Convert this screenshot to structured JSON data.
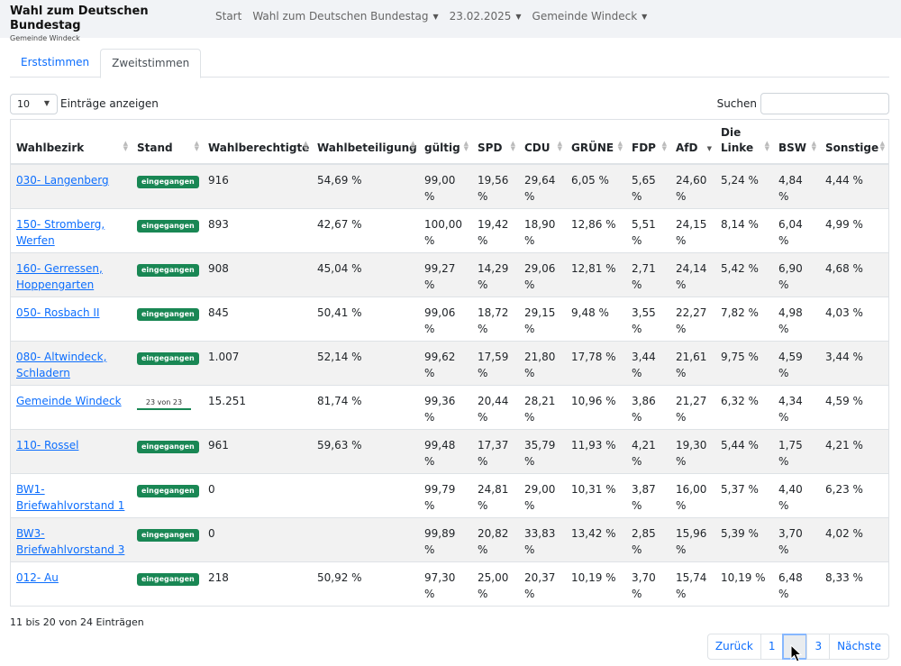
{
  "header": {
    "brand_title": "Wahl zum Deutschen Bundestag",
    "brand_subtitle": "Gemeinde Windeck",
    "nav": [
      {
        "label": "Start",
        "dropdown": false
      },
      {
        "label": "Wahl zum Deutschen Bundestag",
        "dropdown": true
      },
      {
        "label": "23.02.2025",
        "dropdown": true
      },
      {
        "label": "Gemeinde Windeck",
        "dropdown": true
      }
    ]
  },
  "tabs": [
    {
      "label": "Erststimmen",
      "active": false
    },
    {
      "label": "Zweitstimmen",
      "active": true
    }
  ],
  "controls": {
    "length_value": "10",
    "length_label": "Einträge anzeigen",
    "search_label": "Suchen",
    "search_value": ""
  },
  "table": {
    "columns": [
      "Wahlbezirk",
      "Stand",
      "Wahlberechtigte",
      "Wahlbeteiligung",
      "gültig",
      "SPD",
      "CDU",
      "GRÜNE",
      "FDP",
      "AfD",
      "Die Linke",
      "BSW",
      "Sonstige"
    ],
    "sorted_column": "AfD",
    "rows": [
      {
        "district": "030- Langenberg",
        "status": "eingegangen",
        "eligible": "916",
        "turnout": "54,69 %",
        "valid": "99,00 %",
        "spd": "19,56 %",
        "cdu": "29,64 %",
        "gruene": "6,05 %",
        "fdp": "5,65 %",
        "afd": "24,60 %",
        "linke": "5,24 %",
        "bsw": "4,84 %",
        "sonstige": "4,44 %"
      },
      {
        "district": "150- Stromberg, Werfen",
        "status": "eingegangen",
        "eligible": "893",
        "turnout": "42,67 %",
        "valid": "100,00 %",
        "spd": "19,42 %",
        "cdu": "18,90 %",
        "gruene": "12,86 %",
        "fdp": "5,51 %",
        "afd": "24,15 %",
        "linke": "8,14 %",
        "bsw": "6,04 %",
        "sonstige": "4,99 %"
      },
      {
        "district": "160- Gerressen, Hoppengarten",
        "status": "eingegangen",
        "eligible": "908",
        "turnout": "45,04 %",
        "valid": "99,27 %",
        "spd": "14,29 %",
        "cdu": "29,06 %",
        "gruene": "12,81 %",
        "fdp": "2,71 %",
        "afd": "24,14 %",
        "linke": "5,42 %",
        "bsw": "6,90 %",
        "sonstige": "4,68 %"
      },
      {
        "district": "050- Rosbach II",
        "status": "eingegangen",
        "eligible": "845",
        "turnout": "50,41 %",
        "valid": "99,06 %",
        "spd": "18,72 %",
        "cdu": "29,15 %",
        "gruene": "9,48 %",
        "fdp": "3,55 %",
        "afd": "22,27 %",
        "linke": "7,82 %",
        "bsw": "4,98 %",
        "sonstige": "4,03 %"
      },
      {
        "district": "080- Altwindeck, Schladern",
        "status": "eingegangen",
        "eligible": "1.007",
        "turnout": "52,14 %",
        "valid": "99,62 %",
        "spd": "17,59 %",
        "cdu": "21,80 %",
        "gruene": "17,78 %",
        "fdp": "3,44 %",
        "afd": "21,61 %",
        "linke": "9,75 %",
        "bsw": "4,59 %",
        "sonstige": "3,44 %"
      },
      {
        "district": "Gemeinde Windeck",
        "status": "23 von 23",
        "status_type": "progress",
        "progress": 1.0,
        "eligible": "15.251",
        "turnout": "81,74 %",
        "valid": "99,36 %",
        "spd": "20,44 %",
        "cdu": "28,21 %",
        "gruene": "10,96 %",
        "fdp": "3,86 %",
        "afd": "21,27 %",
        "linke": "6,32 %",
        "bsw": "4,34 %",
        "sonstige": "4,59 %"
      },
      {
        "district": "110- Rossel",
        "status": "eingegangen",
        "eligible": "961",
        "turnout": "59,63 %",
        "valid": "99,48 %",
        "spd": "17,37 %",
        "cdu": "35,79 %",
        "gruene": "11,93 %",
        "fdp": "4,21 %",
        "afd": "19,30 %",
        "linke": "5,44 %",
        "bsw": "1,75 %",
        "sonstige": "4,21 %"
      },
      {
        "district": "BW1- Briefwahlvorstand 1",
        "status": "eingegangen",
        "eligible": "0",
        "turnout": "",
        "valid": "99,79 %",
        "spd": "24,81 %",
        "cdu": "29,00 %",
        "gruene": "10,31 %",
        "fdp": "3,87 %",
        "afd": "16,00 %",
        "linke": "5,37 %",
        "bsw": "4,40 %",
        "sonstige": "6,23 %"
      },
      {
        "district": "BW3- Briefwahlvorstand 3",
        "status": "eingegangen",
        "eligible": "0",
        "turnout": "",
        "valid": "99,89 %",
        "spd": "20,82 %",
        "cdu": "33,83 %",
        "gruene": "13,42 %",
        "fdp": "2,85 %",
        "afd": "15,96 %",
        "linke": "5,39 %",
        "bsw": "3,70 %",
        "sonstige": "4,02 %"
      },
      {
        "district": "012- Au",
        "status": "eingegangen",
        "eligible": "218",
        "turnout": "50,92 %",
        "valid": "97,30 %",
        "spd": "25,00 %",
        "cdu": "20,37 %",
        "gruene": "10,19 %",
        "fdp": "3,70 %",
        "afd": "15,74 %",
        "linke": "10,19 %",
        "bsw": "6,48 %",
        "sonstige": "8,33 %"
      }
    ]
  },
  "footer": {
    "info": "11 bis 20 von 24 Einträgen",
    "pagination": {
      "prev": "Zurück",
      "pages": [
        "1",
        "2",
        "3"
      ],
      "current": "2",
      "next": "Nächste"
    }
  },
  "colors": {
    "link": "#0d6efd",
    "badge": "#198754",
    "navbar_bg": "#f1f3f6",
    "row_stripe": "#f2f2f2"
  }
}
